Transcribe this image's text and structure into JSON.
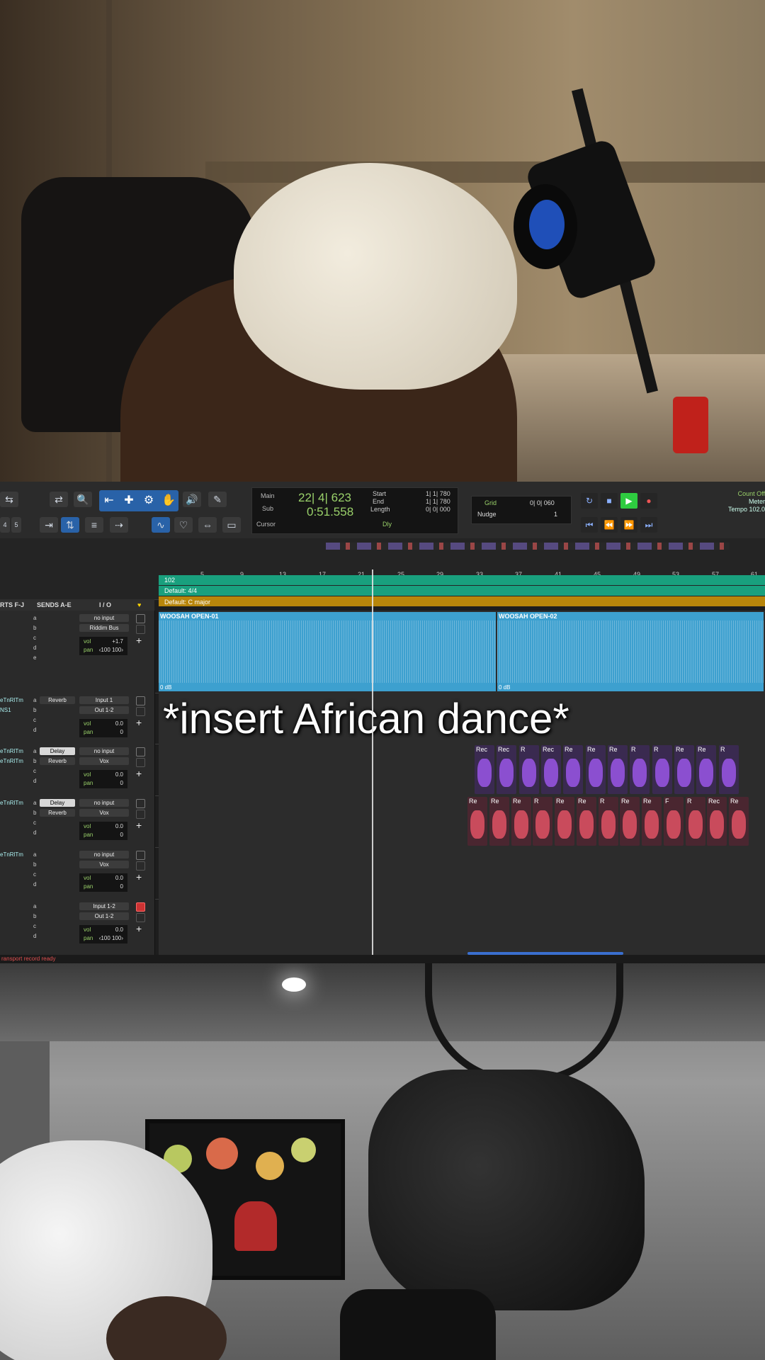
{
  "caption": "*insert African dance*",
  "toolbar": {
    "counter": {
      "main_label": "Main",
      "main_value": "22| 4| 623",
      "sub_label": "Sub",
      "sub_value": "0:51.558",
      "cursor_label": "Cursor",
      "start_label": "Start",
      "end_label": "End",
      "length_label": "Length",
      "start_value": "1| 1| 780",
      "end_value": "1| 1| 780",
      "length_value": "0| 0| 000",
      "dly_label": "Dly"
    },
    "grid": {
      "grid_label": "Grid",
      "grid_value": "0| 0| 060",
      "nudge_label": "Nudge",
      "nudge_value": "1"
    },
    "count_off": "Count Off",
    "meter_label": "Meter",
    "tempo_label": "Tempo",
    "tempo_value": "102.0",
    "track_nums": [
      "4",
      "5"
    ]
  },
  "ruler": {
    "bars": [
      "5",
      "9",
      "13",
      "17",
      "21",
      "25",
      "29",
      "33",
      "37",
      "41",
      "45",
      "49",
      "53",
      "57",
      "61"
    ],
    "tempo_marker": "102",
    "meter_marker": "Default: 4/4",
    "key_marker": "Default: C major"
  },
  "mix_header": {
    "inserts": "RTS F-J",
    "sends": "SENDS A-E",
    "io": "I / O"
  },
  "tracks": [
    {
      "inserts": [],
      "sends": [
        {
          "letter": "a",
          "name": ""
        },
        {
          "letter": "b",
          "name": ""
        },
        {
          "letter": "c",
          "name": ""
        },
        {
          "letter": "d",
          "name": ""
        },
        {
          "letter": "e",
          "name": ""
        }
      ],
      "io_in": "no input",
      "io_out": "Riddim Bus",
      "vol": "+1.7",
      "pan": "‹100  100›",
      "clips": [
        {
          "name": "WOOSAH OPEN-01",
          "gain": "0 dB"
        },
        {
          "name": "WOOSAH OPEN-02",
          "gain": "0 dB"
        }
      ]
    },
    {
      "inserts": [
        "eTnRlTm",
        "NS1"
      ],
      "sends": [
        {
          "letter": "a",
          "name": "Reverb"
        },
        {
          "letter": "b",
          "name": ""
        },
        {
          "letter": "c",
          "name": ""
        },
        {
          "letter": "d",
          "name": ""
        }
      ],
      "io_in": "Input 1",
      "io_out": "Out 1-2",
      "vol": "0.0",
      "pan": "0"
    },
    {
      "inserts": [
        "eTnRlTm",
        "eTnRlTm"
      ],
      "sends": [
        {
          "letter": "a",
          "name": "Delay"
        },
        {
          "letter": "b",
          "name": "Reverb"
        },
        {
          "letter": "c",
          "name": ""
        },
        {
          "letter": "d",
          "name": ""
        }
      ],
      "io_in": "no input",
      "io_out": "Vox",
      "vol": "0.0",
      "pan": "0",
      "clip_labels": [
        "Rec",
        "Rec",
        "R",
        "Rec",
        "Re",
        "Re",
        "Re",
        "R",
        "R",
        "Re",
        "Re",
        "R"
      ]
    },
    {
      "inserts": [
        "eTnRlTm"
      ],
      "sends": [
        {
          "letter": "a",
          "name": "Delay"
        },
        {
          "letter": "b",
          "name": "Reverb"
        },
        {
          "letter": "c",
          "name": ""
        },
        {
          "letter": "d",
          "name": ""
        }
      ],
      "io_in": "no input",
      "io_out": "Vox",
      "vol": "0.0",
      "pan": "0",
      "clip_labels": [
        "Re",
        "Re",
        "Re",
        "R",
        "Re",
        "Re",
        "R",
        "Re",
        "Re",
        "F",
        "R",
        "Rec",
        "Re"
      ]
    },
    {
      "inserts": [
        "eTnRlTm"
      ],
      "sends": [
        {
          "letter": "a",
          "name": ""
        },
        {
          "letter": "b",
          "name": ""
        },
        {
          "letter": "c",
          "name": ""
        },
        {
          "letter": "d",
          "name": ""
        }
      ],
      "io_in": "no input",
      "io_out": "Vox",
      "vol": "0.0",
      "pan": "0"
    },
    {
      "inserts": [],
      "sends": [
        {
          "letter": "a",
          "name": ""
        },
        {
          "letter": "b",
          "name": ""
        },
        {
          "letter": "c",
          "name": ""
        },
        {
          "letter": "d",
          "name": ""
        }
      ],
      "io_in": "Input 1-2",
      "io_out": "Out 1-2",
      "vol": "0.0",
      "pan": "‹100  100›",
      "armed": true
    }
  ],
  "status": "ransport record ready",
  "colors": {
    "audio_clip": "#3da0cf",
    "midi_purple": "#8b4fd0",
    "midi_red": "#c94b5c",
    "tempo_ruler": "#19a07e",
    "key_ruler": "#b8860b",
    "selected_tool": "#2962a8"
  }
}
